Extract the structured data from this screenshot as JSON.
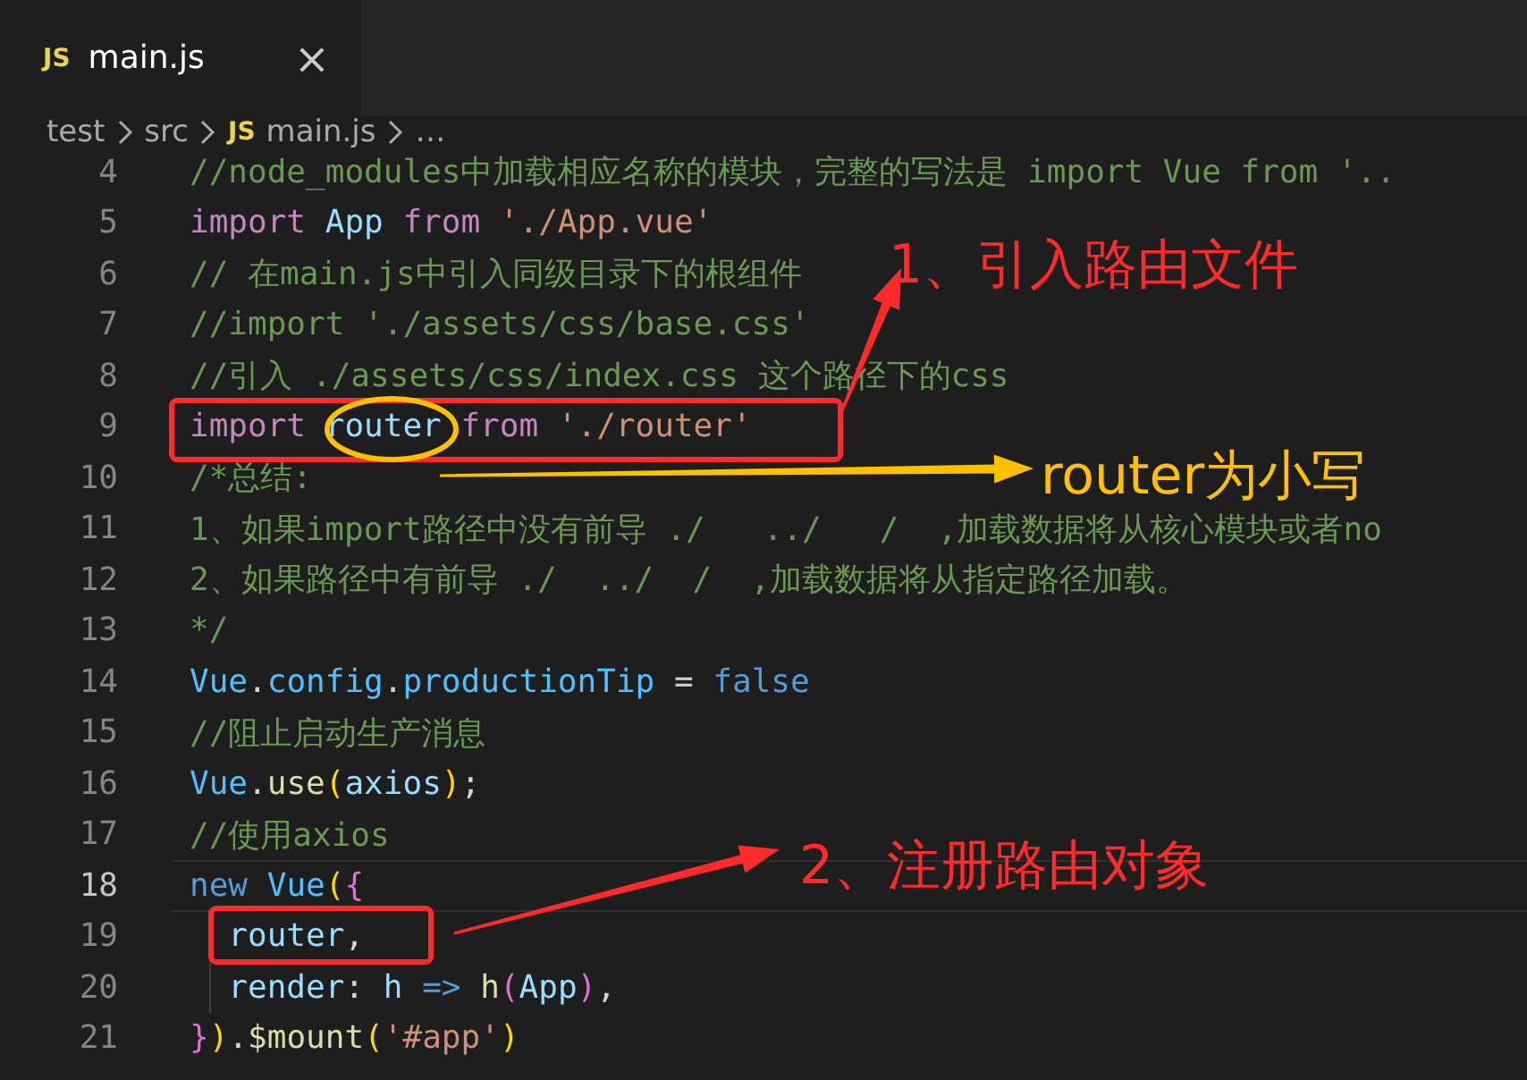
{
  "tabs": [
    {
      "icon_text": "JS",
      "label": "main.js",
      "selected": true,
      "close": "×"
    }
  ],
  "breadcrumb": [
    {
      "text": "test"
    },
    {
      "text": "src"
    },
    {
      "icon_text": "JS",
      "text": "main.js"
    },
    {
      "text": "…"
    }
  ],
  "lines": [
    {
      "number": "4",
      "current": false,
      "tokens": [
        {
          "text": "//node_modules中加载相应名称的模块，完整的写法是 import Vue from '..",
          "kind": "comment"
        }
      ]
    },
    {
      "number": "5",
      "current": false,
      "tokens": [
        {
          "text": "import ",
          "kind": "import"
        },
        {
          "text": "App ",
          "kind": "var"
        },
        {
          "text": "from ",
          "kind": "import"
        },
        {
          "text": "'./App.vue'",
          "kind": "string"
        }
      ]
    },
    {
      "number": "6",
      "current": false,
      "tokens": [
        {
          "text": "// 在main.js中引入同级目录下的根组件",
          "kind": "comment"
        }
      ]
    },
    {
      "number": "7",
      "current": false,
      "tokens": [
        {
          "text": "//import './assets/css/base.css'",
          "kind": "comment"
        }
      ]
    },
    {
      "number": "8",
      "current": false,
      "tokens": [
        {
          "text": "//引入 ./assets/css/index.css 这个路径下的css",
          "kind": "comment"
        }
      ]
    },
    {
      "number": "9",
      "current": false,
      "tokens": [
        {
          "text": "import ",
          "kind": "import"
        },
        {
          "text": "router ",
          "kind": "var"
        },
        {
          "text": "from ",
          "kind": "import"
        },
        {
          "text": "'./router'",
          "kind": "string"
        }
      ]
    },
    {
      "number": "10",
      "current": false,
      "tokens": [
        {
          "text": "/*总结:",
          "kind": "comment"
        }
      ]
    },
    {
      "number": "11",
      "current": false,
      "tokens": [
        {
          "text": "1、如果import路径中没有前导 ./   ../   /  ,加载数据将从核心模块或者no",
          "kind": "comment"
        }
      ]
    },
    {
      "number": "12",
      "current": false,
      "tokens": [
        {
          "text": "2、如果路径中有前导 ./  ../  /  ,加载数据将从指定路径加载。",
          "kind": "comment"
        }
      ]
    },
    {
      "number": "13",
      "current": false,
      "tokens": [
        {
          "text": "*/",
          "kind": "comment"
        }
      ]
    },
    {
      "number": "14",
      "current": false,
      "tokens": [
        {
          "text": "Vue",
          "kind": "class"
        },
        {
          "text": ".",
          "kind": "plain"
        },
        {
          "text": "config",
          "kind": "class"
        },
        {
          "text": ".",
          "kind": "plain"
        },
        {
          "text": "productionTip",
          "kind": "class"
        },
        {
          "text": " = ",
          "kind": "plain"
        },
        {
          "text": "false",
          "kind": "keyword"
        }
      ]
    },
    {
      "number": "15",
      "current": false,
      "tokens": [
        {
          "text": "//阻止启动生产消息",
          "kind": "comment"
        }
      ]
    },
    {
      "number": "16",
      "current": false,
      "tokens": [
        {
          "text": "Vue",
          "kind": "class"
        },
        {
          "text": ".",
          "kind": "plain"
        },
        {
          "text": "use",
          "kind": "function"
        },
        {
          "text": "(",
          "kind": "bracket"
        },
        {
          "text": "axios",
          "kind": "var"
        },
        {
          "text": ")",
          "kind": "bracket"
        },
        {
          "text": ";",
          "kind": "plain"
        }
      ]
    },
    {
      "number": "17",
      "current": false,
      "tokens": [
        {
          "text": "//使用axios",
          "kind": "comment"
        }
      ]
    },
    {
      "number": "18",
      "current": true,
      "tokens": [
        {
          "text": "new ",
          "kind": "keyword"
        },
        {
          "text": "Vue",
          "kind": "class"
        },
        {
          "text": "(",
          "kind": "bracket"
        },
        {
          "text": "{",
          "kind": "bracket2"
        }
      ]
    },
    {
      "number": "19",
      "current": false,
      "tokens": [
        {
          "text": "  router",
          "kind": "var"
        },
        {
          "text": ",",
          "kind": "plain"
        }
      ]
    },
    {
      "number": "20",
      "current": false,
      "tokens": [
        {
          "text": "  render",
          "kind": "var"
        },
        {
          "text": ": ",
          "kind": "plain"
        },
        {
          "text": "h",
          "kind": "var"
        },
        {
          "text": " => ",
          "kind": "keyword"
        },
        {
          "text": "h",
          "kind": "function"
        },
        {
          "text": "(",
          "kind": "bracket2"
        },
        {
          "text": "App",
          "kind": "var"
        },
        {
          "text": ")",
          "kind": "bracket2"
        },
        {
          "text": ",",
          "kind": "plain"
        }
      ]
    },
    {
      "number": "21",
      "current": false,
      "tokens": [
        {
          "text": "}",
          "kind": "bracket2"
        },
        {
          "text": ")",
          "kind": "bracket"
        },
        {
          "text": ".",
          "kind": "plain"
        },
        {
          "text": "$mount",
          "kind": "function"
        },
        {
          "text": "(",
          "kind": "bracket"
        },
        {
          "text": "'#app'",
          "kind": "string"
        },
        {
          "text": ")",
          "kind": "bracket"
        }
      ]
    }
  ],
  "annotations": [
    {
      "kind": "box",
      "color": "#ff2a2a"
    },
    {
      "kind": "circle",
      "color": "#ffc000"
    },
    {
      "kind": "arrow",
      "color": "#ff2a2a"
    },
    {
      "kind": "label",
      "color": "#ff2a2a",
      "text": "1、引入路由文件"
    },
    {
      "kind": "arrow",
      "color": "#ffc000"
    },
    {
      "kind": "label",
      "color": "#ffc000",
      "text": "router为小写"
    },
    {
      "kind": "box",
      "color": "#ff2a2a"
    },
    {
      "kind": "arrow",
      "color": "#ff2a2a"
    },
    {
      "kind": "label",
      "color": "#ff2a2a",
      "text": "2、注册路由对象"
    }
  ]
}
